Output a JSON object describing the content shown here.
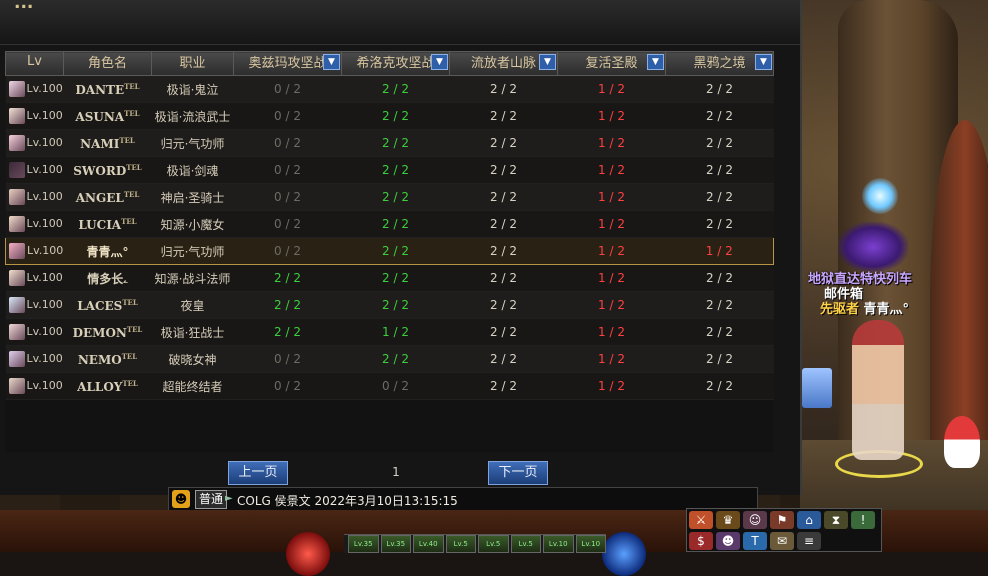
{
  "panel": {
    "title": "..."
  },
  "table": {
    "headers": [
      {
        "label": "Lv",
        "dropdown": false
      },
      {
        "label": "角色名",
        "dropdown": false
      },
      {
        "label": "职业",
        "dropdown": false
      },
      {
        "label": "奥兹玛攻坚战",
        "dropdown": true
      },
      {
        "label": "希洛克攻坚战",
        "dropdown": true
      },
      {
        "label": "流放者山脉",
        "dropdown": true
      },
      {
        "label": "复活圣殿",
        "dropdown": true
      },
      {
        "label": "黑鸦之境",
        "dropdown": true
      }
    ],
    "rows": [
      {
        "lv": "Lv.100",
        "name": "DANTE",
        "tag": "TEL",
        "cls": "极诣·鬼泣",
        "ozma": "0 / 2",
        "ozma_c": "c-gray",
        "siroco": "2 / 2",
        "siroco_c": "c-green",
        "exile": "2 / 2",
        "exile_c": "c-white",
        "temple": "1 / 2",
        "temple_c": "c-red",
        "raven": "2 / 2",
        "raven_c": "c-white"
      },
      {
        "lv": "Lv.100",
        "name": "ASUNA",
        "tag": "TEL",
        "cls": "极诣·流浪武士",
        "ozma": "0 / 2",
        "ozma_c": "c-gray",
        "siroco": "2 / 2",
        "siroco_c": "c-green",
        "exile": "2 / 2",
        "exile_c": "c-white",
        "temple": "1 / 2",
        "temple_c": "c-red",
        "raven": "2 / 2",
        "raven_c": "c-white"
      },
      {
        "lv": "Lv.100",
        "name": "NAMI",
        "tag": "TEL",
        "cls": "归元·气功师",
        "ozma": "0 / 2",
        "ozma_c": "c-gray",
        "siroco": "2 / 2",
        "siroco_c": "c-green",
        "exile": "2 / 2",
        "exile_c": "c-white",
        "temple": "1 / 2",
        "temple_c": "c-red",
        "raven": "2 / 2",
        "raven_c": "c-white"
      },
      {
        "lv": "Lv.100",
        "name": "SWORD",
        "tag": "TEL",
        "cls": "极诣·剑魂",
        "ozma": "0 / 2",
        "ozma_c": "c-gray",
        "siroco": "2 / 2",
        "siroco_c": "c-green",
        "exile": "2 / 2",
        "exile_c": "c-white",
        "temple": "1 / 2",
        "temple_c": "c-red",
        "raven": "2 / 2",
        "raven_c": "c-white"
      },
      {
        "lv": "Lv.100",
        "name": "ANGEL",
        "tag": "TEL",
        "cls": "神启·圣骑士",
        "ozma": "0 / 2",
        "ozma_c": "c-gray",
        "siroco": "2 / 2",
        "siroco_c": "c-green",
        "exile": "2 / 2",
        "exile_c": "c-white",
        "temple": "1 / 2",
        "temple_c": "c-red",
        "raven": "2 / 2",
        "raven_c": "c-white"
      },
      {
        "lv": "Lv.100",
        "name": "LUCIA",
        "tag": "TEL",
        "cls": "知源·小魔女",
        "ozma": "0 / 2",
        "ozma_c": "c-gray",
        "siroco": "2 / 2",
        "siroco_c": "c-green",
        "exile": "2 / 2",
        "exile_c": "c-white",
        "temple": "1 / 2",
        "temple_c": "c-red",
        "raven": "2 / 2",
        "raven_c": "c-white"
      },
      {
        "lv": "Lv.100",
        "name": "青青灬°",
        "tag": "",
        "cls": "归元·气功师",
        "ozma": "0 / 2",
        "ozma_c": "c-gray",
        "siroco": "2 / 2",
        "siroco_c": "c-green",
        "exile": "2 / 2",
        "exile_c": "c-white",
        "temple": "1 / 2",
        "temple_c": "c-red",
        "raven": "1 / 2",
        "raven_c": "c-red",
        "selected": true
      },
      {
        "lv": "Lv.100",
        "name": "情多长ۦ",
        "tag": "",
        "cls": "知源·战斗法师",
        "ozma": "2 / 2",
        "ozma_c": "c-green",
        "siroco": "2 / 2",
        "siroco_c": "c-green",
        "exile": "2 / 2",
        "exile_c": "c-white",
        "temple": "1 / 2",
        "temple_c": "c-red",
        "raven": "2 / 2",
        "raven_c": "c-white"
      },
      {
        "lv": "Lv.100",
        "name": "LACES",
        "tag": "TEL",
        "cls": "夜皇",
        "ozma": "2 / 2",
        "ozma_c": "c-green",
        "siroco": "2 / 2",
        "siroco_c": "c-green",
        "exile": "2 / 2",
        "exile_c": "c-white",
        "temple": "1 / 2",
        "temple_c": "c-red",
        "raven": "2 / 2",
        "raven_c": "c-white"
      },
      {
        "lv": "Lv.100",
        "name": "DEMON",
        "tag": "TEL",
        "cls": "极诣·狂战士",
        "ozma": "2 / 2",
        "ozma_c": "c-green",
        "siroco": "1 / 2",
        "siroco_c": "c-green",
        "exile": "2 / 2",
        "exile_c": "c-white",
        "temple": "1 / 2",
        "temple_c": "c-red",
        "raven": "2 / 2",
        "raven_c": "c-white"
      },
      {
        "lv": "Lv.100",
        "name": "NEMO",
        "tag": "TEL",
        "cls": "破晓女神",
        "ozma": "0 / 2",
        "ozma_c": "c-gray",
        "siroco": "2 / 2",
        "siroco_c": "c-green",
        "exile": "2 / 2",
        "exile_c": "c-white",
        "temple": "1 / 2",
        "temple_c": "c-red",
        "raven": "2 / 2",
        "raven_c": "c-white"
      },
      {
        "lv": "Lv.100",
        "name": "ALLOY",
        "tag": "TEL",
        "cls": "超能终结者",
        "ozma": "0 / 2",
        "ozma_c": "c-gray",
        "siroco": "0 / 2",
        "siroco_c": "c-gray",
        "exile": "2 / 2",
        "exile_c": "c-white",
        "temple": "1 / 2",
        "temple_c": "c-red",
        "raven": "2 / 2",
        "raven_c": "c-white"
      }
    ]
  },
  "pager": {
    "prev_label": "上一页",
    "next_label": "下一页",
    "current": "1"
  },
  "chat": {
    "mode": "普通",
    "message": "COLG  侯景文  2022年3月10日13:15:15"
  },
  "scene": {
    "npc_title": "地狱直达特快列车",
    "npc_sub": "邮件箱",
    "player_prefix": "先驱者",
    "player_name": "青青灬°"
  },
  "hud": {
    "skills": [
      "Lv.35",
      "Lv.35",
      "Lv.40",
      "Lv.5",
      "Lv.5",
      "Lv.5",
      "Lv.10",
      "Lv.10"
    ]
  },
  "colors": {
    "green": "#3ccf3c",
    "red": "#ff4040",
    "gray": "#6e6a64",
    "accent": "#2f5fa8",
    "selected_border": "#b89445"
  }
}
